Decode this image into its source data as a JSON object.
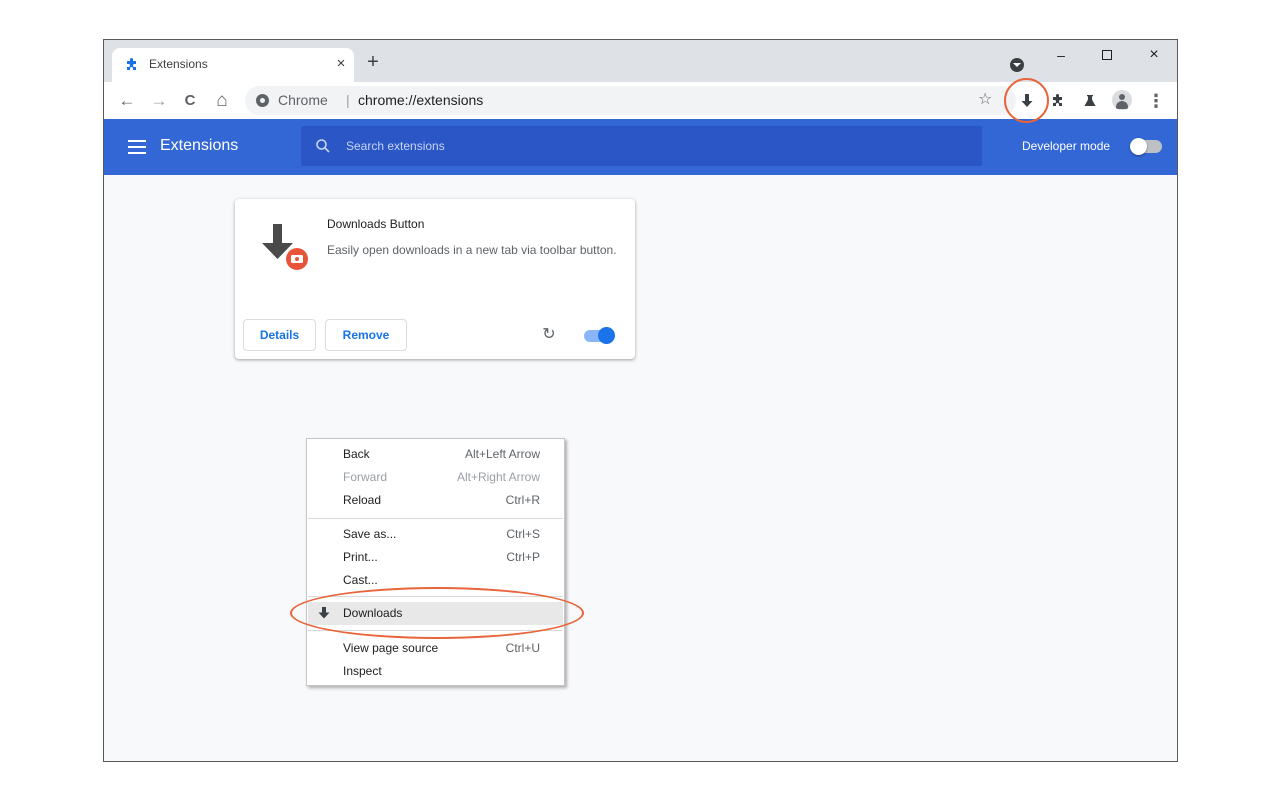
{
  "tab": {
    "title": "Extensions",
    "close": "×",
    "new_tab": "+"
  },
  "window_controls": {
    "minimize": "–",
    "close": "×"
  },
  "toolbar": {
    "back": "←",
    "forward": "→",
    "reload": "C",
    "home": "⌂",
    "origin": "Chrome",
    "separator": "|",
    "url": "chrome://extensions",
    "bookmark": "☆",
    "menu": "⋮"
  },
  "header": {
    "title": "Extensions",
    "search_placeholder": "Search extensions",
    "developer_mode_label": "Developer mode",
    "developer_mode_on": false
  },
  "extension_card": {
    "name": "Downloads Button",
    "description": "Easily open downloads in a new tab via toolbar button.",
    "details_label": "Details",
    "remove_label": "Remove",
    "reload_icon": "↻",
    "enabled": true
  },
  "context_menu": {
    "groups": [
      [
        {
          "label": "Back",
          "shortcut": "Alt+Left Arrow",
          "disabled": false
        },
        {
          "label": "Forward",
          "shortcut": "Alt+Right Arrow",
          "disabled": true
        },
        {
          "label": "Reload",
          "shortcut": "Ctrl+R",
          "disabled": false
        }
      ],
      [
        {
          "label": "Save as...",
          "shortcut": "Ctrl+S",
          "disabled": false
        },
        {
          "label": "Print...",
          "shortcut": "Ctrl+P",
          "disabled": false
        },
        {
          "label": "Cast...",
          "shortcut": "",
          "disabled": false
        }
      ],
      [
        {
          "label": "Downloads",
          "shortcut": "",
          "disabled": false,
          "icon": "download-icon",
          "highlighted": true
        }
      ],
      [
        {
          "label": "View page source",
          "shortcut": "Ctrl+U",
          "disabled": false
        },
        {
          "label": "Inspect",
          "shortcut": "",
          "disabled": false
        }
      ]
    ]
  },
  "colors": {
    "header_blue": "#3367d6",
    "search_blue": "#2a56c6",
    "accent_blue": "#1a73e8",
    "annotation_orange": "#e8643a",
    "badge_orange": "#e8543a"
  }
}
